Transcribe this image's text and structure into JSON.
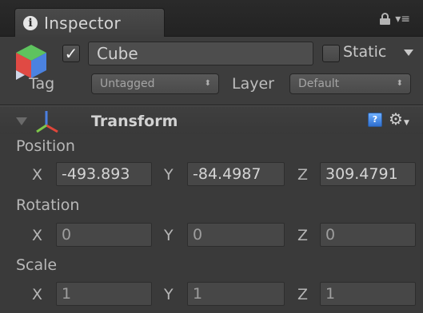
{
  "tab": {
    "icon": "info-icon",
    "info_glyph": "i",
    "label": "Inspector",
    "tools": [
      "lock-icon",
      "menu-icon"
    ]
  },
  "game_object": {
    "icon": "cube-icon",
    "active_check": "✓",
    "name": "Cube",
    "static_label": "Static",
    "tag_label": "Tag",
    "tag_value": "Untagged",
    "layer_label": "Layer",
    "layer_value": "Default",
    "dropdown_arrows": "⬍"
  },
  "transform": {
    "title": "Transform",
    "help_glyph": "?",
    "gear_glyph": "⚙",
    "gear_caret": "▼",
    "position": {
      "label": "Position",
      "x_label": "X",
      "x": "-493.893",
      "y_label": "Y",
      "y": "-84.4987",
      "z_label": "Z",
      "z": "309.4791"
    },
    "rotation": {
      "label": "Rotation",
      "x_label": "X",
      "x": "0",
      "y_label": "Y",
      "y": "0",
      "z_label": "Z",
      "z": "0"
    },
    "scale": {
      "label": "Scale",
      "x_label": "X",
      "x": "1",
      "y_label": "Y",
      "y": "1",
      "z_label": "Z",
      "z": "1"
    }
  },
  "colors": {
    "panel_bg": "#3a3a3a",
    "field_bg": "#474747",
    "axis_x": "#e0463a",
    "axis_y": "#7ec84a",
    "axis_z": "#4a7fe0",
    "help_blue": "#3f86e8"
  }
}
